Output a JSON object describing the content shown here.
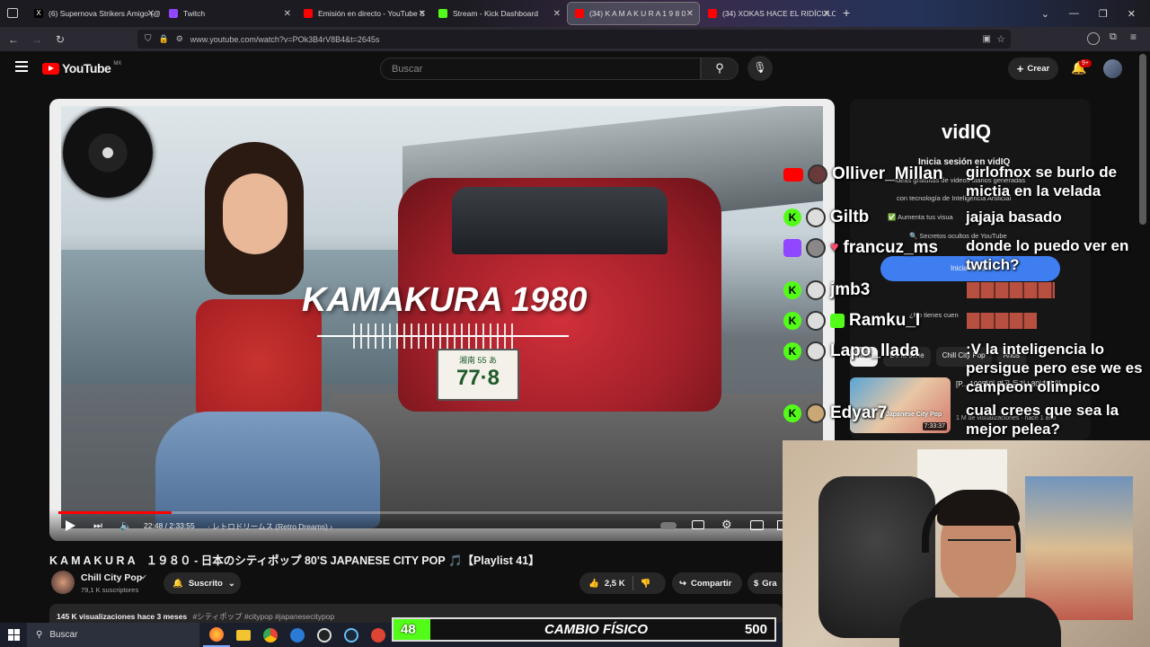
{
  "browser": {
    "tabs": [
      {
        "title": "(6) Supernova Strikers Amigo (@",
        "color": "#e6e6e6"
      },
      {
        "title": "Twitch",
        "color": "#9146ff"
      },
      {
        "title": "Emisión en directo - YouTube S",
        "color": "#ff0000"
      },
      {
        "title": "Stream - Kick Dashboard",
        "color": "#53fc18"
      },
      {
        "title": "(34) K A M A K U R A   1 9 8 0",
        "color": "#ff0000"
      },
      {
        "title": "(34) XOKAS HACE EL RIDÍCULO",
        "color": "#ff0000"
      }
    ],
    "url": "www.youtube.com/watch?v=POk3B4rV8B4&t=2645s"
  },
  "youtube": {
    "logo": "YouTube",
    "region": "MX",
    "search_placeholder": "Buscar",
    "create_label": "Crear",
    "notif_count": "9+"
  },
  "video": {
    "overlay_title": "KAMAKURA 1980",
    "plate_top": "湘南 55 あ",
    "plate_num": "77·8",
    "time": "22:48 / 2:33:55",
    "chapter": "レトロドリームス (Retro Dreams)",
    "progress": 0.148,
    "title": "K A M A K U R A　１９８０ - 日本のシティポップ 80'S JAPANESE CITY POP 🎵【Playlist 41】",
    "channel": "Chill City Pop",
    "subs": "79,1 K suscriptores",
    "subscribed_label": "Suscrito",
    "likes": "2,5 K",
    "share_label": "Compartir",
    "more_label": "Gra",
    "meta": "145 K visualizaciones  hace 3 meses",
    "tags": "#シティポップ #citypop #japanesecitypop"
  },
  "vidiq": {
    "brand": "vidIQ",
    "signin_title": "Inicia sesión en vidIQ",
    "line1": "Ideas gratuitas de videos diarios generadas",
    "line2": "con tecnología de Inteligencia Artificial",
    "line3": "✅ Aumenta tus visua",
    "line4": "🔍 Secretos ocultos de YouTube",
    "signin_button": "Inicia sesión",
    "no_account": "¿No tienes cuen",
    "chips": [
      "Todo",
      "De la serie",
      "Chill City Pop",
      "Anos"
    ],
    "rec_title": "[P... 100명의 명곡 듣기 | 80년대 일...",
    "rec_meta": "1 M de visualizaciones · hace 1 año",
    "rec_duration": "7:33:37",
    "rec_thumb_text": "Japanese City Pop"
  },
  "chat": {
    "users": [
      {
        "name": "Olliver_Millan",
        "badge": "yt"
      },
      {
        "name": "Giltb",
        "badge": "kick"
      },
      {
        "name": "francuz_ms",
        "badge": "twitch"
      },
      {
        "name": "jmb3",
        "badge": "kick"
      },
      {
        "name": "Ramku_I",
        "badge": "kick"
      },
      {
        "name": "Lapo_llada",
        "badge": "kick"
      },
      {
        "name": "Edyar7",
        "badge": "kick"
      }
    ],
    "messages": [
      "girlofnox se burlo de mictia en la velada",
      "jajaja basado",
      "donde lo puedo ver en twtich?",
      ":V la inteligencia lo persigue pero ese we es campeon olimpico",
      "cual crees que sea la mejor pelea?"
    ]
  },
  "overlay": {
    "left_value": "48",
    "label": "CAMBIO FÍSICO",
    "right_value": "500",
    "fill": 0.096
  },
  "taskbar": {
    "search_label": "Buscar"
  }
}
